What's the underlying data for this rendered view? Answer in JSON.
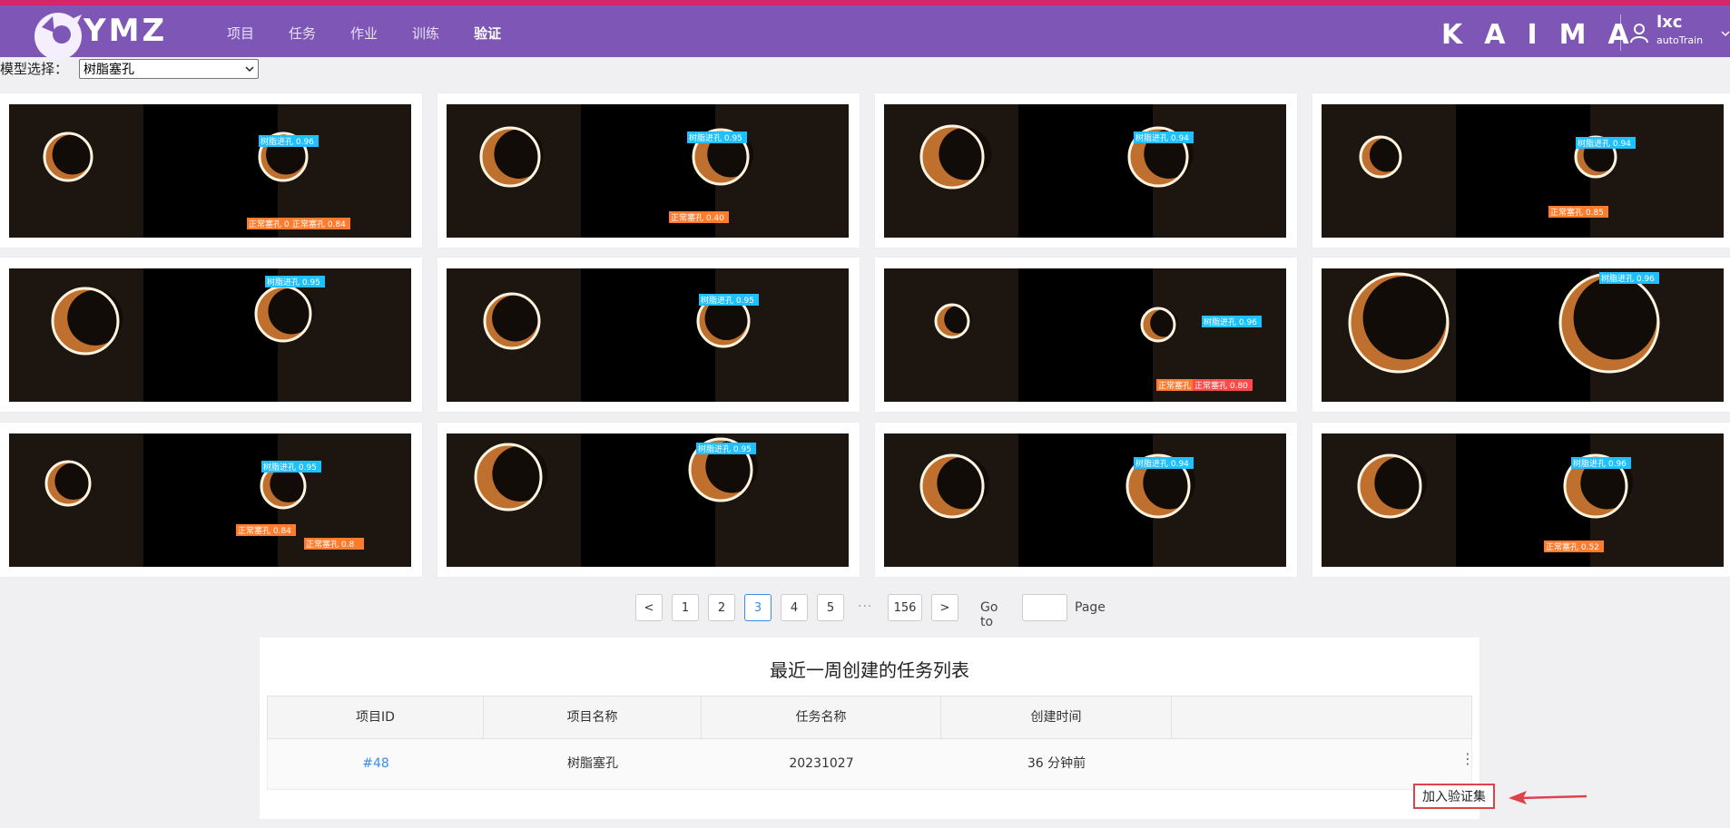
{
  "brand": {
    "logo_text": "YMZ",
    "company": "KAIMA"
  },
  "nav": {
    "items": [
      "项目",
      "任务",
      "作业",
      "训练",
      "验证"
    ],
    "active_index": 4
  },
  "user": {
    "name": "lxc",
    "role": "autoTrain"
  },
  "model_select": {
    "label": "模型选择：",
    "value": "树脂塞孔"
  },
  "gallery": {
    "cards": [
      {
        "labels": [
          "树脂进孔 0.96",
          "正常塞孔 0.87",
          "正常塞孔 0.84"
        ]
      },
      {
        "labels": [
          "树脂进孔 0.95",
          "正常塞孔 0.40"
        ]
      },
      {
        "labels": [
          "树脂进孔 0.94"
        ]
      },
      {
        "labels": [
          "树脂进孔 0.94",
          "正常塞孔 0.85"
        ]
      },
      {
        "labels": [
          "树脂进孔 0.95"
        ]
      },
      {
        "labels": [
          "树脂进孔 0.95"
        ]
      },
      {
        "labels": [
          "树脂进孔 0.96",
          "正常塞孔 0.80",
          "正常塞孔 0.80"
        ]
      },
      {
        "labels": [
          "树脂进孔 0.96"
        ]
      },
      {
        "labels": [
          "树脂进孔 0.95",
          "正常塞孔 0.84",
          "正常塞孔 0.8"
        ]
      },
      {
        "labels": [
          "树脂进孔 0.95"
        ]
      },
      {
        "labels": [
          "树脂进孔 0.94"
        ]
      },
      {
        "labels": [
          "树脂进孔 0.96",
          "正常塞孔 0.52"
        ]
      }
    ]
  },
  "pagination": {
    "prev": "<",
    "next": ">",
    "pages": [
      "1",
      "2",
      "3",
      "4",
      "5"
    ],
    "current": "3",
    "ellipsis": "···",
    "last": "156",
    "goto_label": "Go to",
    "page_label": "Page"
  },
  "task_list": {
    "title": "最近一周创建的任务列表",
    "columns": [
      "项目ID",
      "项目名称",
      "任务名称",
      "创建时间",
      ""
    ],
    "rows": [
      {
        "project_id": "#48",
        "project_name": "树脂塞孔",
        "task_name": "20231027",
        "created": "36 分钟前",
        "menu": "⋮"
      }
    ],
    "popup_action": "加入验证集"
  },
  "colors": {
    "navbar": "#7e57b6",
    "accent_top": "#d6246e",
    "label_blue": "#1ec0ff",
    "label_orange": "#ff7b2e",
    "label_red": "#ff4a4a",
    "link": "#3a8ee6",
    "annotation_red": "#e0424a"
  }
}
